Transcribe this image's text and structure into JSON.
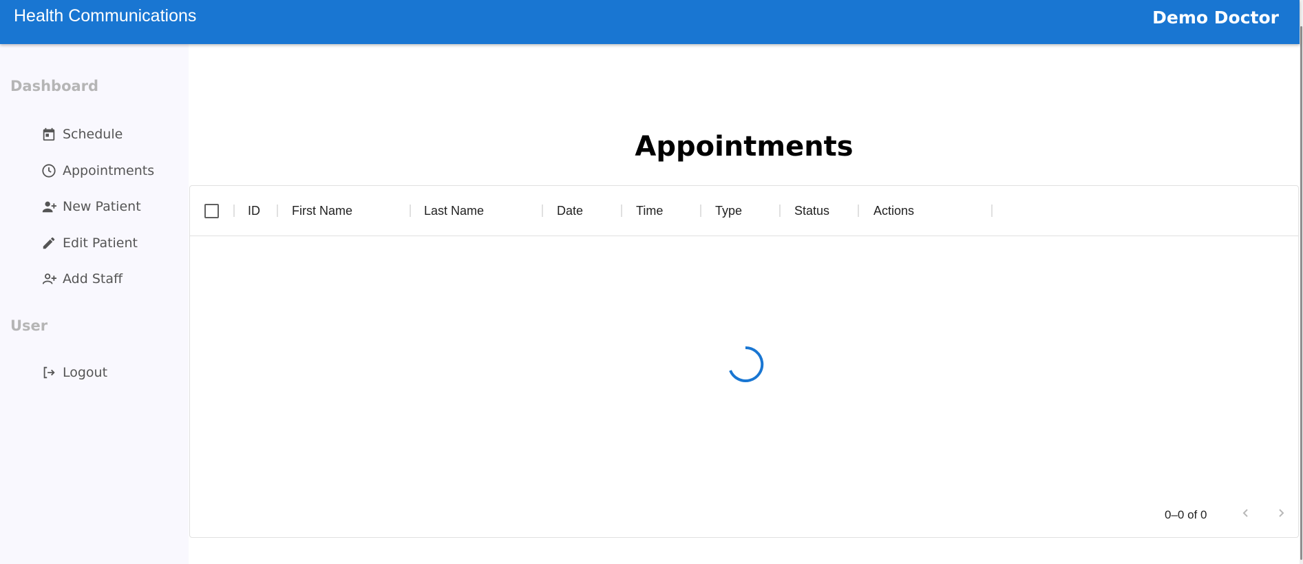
{
  "header": {
    "app_title": "Health Communications",
    "user_name": "Demo Doctor"
  },
  "sidebar": {
    "sections": [
      {
        "heading": "Dashboard",
        "items": [
          {
            "label": "Schedule",
            "icon": "calendar-icon"
          },
          {
            "label": "Appointments",
            "icon": "clock-icon"
          },
          {
            "label": "New Patient",
            "icon": "person-add-icon"
          },
          {
            "label": "Edit Patient",
            "icon": "pencil-icon"
          },
          {
            "label": "Add Staff",
            "icon": "person-add-outline-icon"
          }
        ]
      },
      {
        "heading": "User",
        "items": [
          {
            "label": "Logout",
            "icon": "logout-icon"
          }
        ]
      }
    ]
  },
  "main": {
    "title": "Appointments",
    "table": {
      "columns": [
        "ID",
        "First Name",
        "Last Name",
        "Date",
        "Time",
        "Type",
        "Status",
        "Actions"
      ],
      "rows": [],
      "loading": true
    },
    "pagination": {
      "range_text": "0–0 of 0"
    }
  },
  "colors": {
    "primary": "#1976d2",
    "sidebar_bg": "#f9f8fe",
    "section_heading": "#b5b5b5"
  }
}
